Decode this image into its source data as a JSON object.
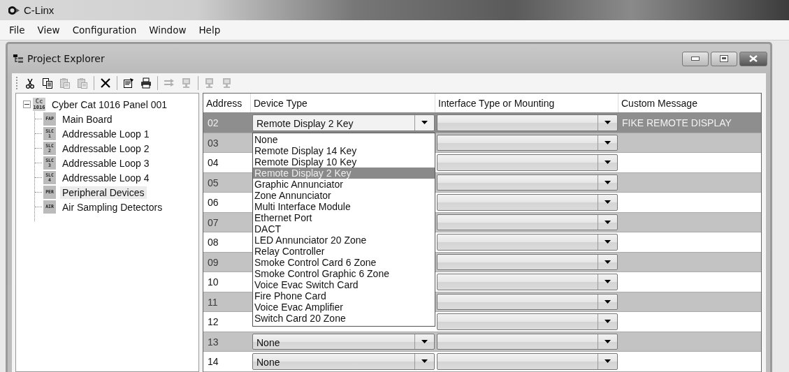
{
  "app": {
    "title": "C-Linx"
  },
  "menu": [
    {
      "label": "File"
    },
    {
      "label": "View"
    },
    {
      "label": "Configuration"
    },
    {
      "label": "Window"
    },
    {
      "label": "Help"
    }
  ],
  "child_window": {
    "title": "Project Explorer"
  },
  "toolbar": [
    {
      "kind": "cut",
      "disabled": false
    },
    {
      "kind": "copy",
      "disabled": false
    },
    {
      "kind": "paste",
      "disabled": true
    },
    {
      "kind": "paste",
      "disabled": true
    },
    {
      "kind": "separator"
    },
    {
      "kind": "delete",
      "disabled": false
    },
    {
      "kind": "separator"
    },
    {
      "kind": "properties",
      "disabled": false
    },
    {
      "kind": "print",
      "disabled": false
    },
    {
      "kind": "separator"
    },
    {
      "kind": "forward",
      "disabled": true
    },
    {
      "kind": "monitor",
      "disabled": true
    },
    {
      "kind": "separator"
    },
    {
      "kind": "monitor",
      "disabled": true
    },
    {
      "kind": "monitor",
      "disabled": true
    }
  ],
  "tree": {
    "label": "Cyber Cat 1016 Panel 001",
    "badge_lines": [
      "Cc",
      "1016"
    ],
    "expanded": true,
    "selected": false,
    "children": [
      {
        "label": "Main Board",
        "badge_lines": [
          "FAP"
        ],
        "selected": false
      },
      {
        "label": "Addressable Loop 1",
        "badge_lines": [
          "SLC",
          "1"
        ],
        "selected": false
      },
      {
        "label": "Addressable Loop 2",
        "badge_lines": [
          "SLC",
          "2"
        ],
        "selected": false
      },
      {
        "label": "Addressable Loop 3",
        "badge_lines": [
          "SLC",
          "3"
        ],
        "selected": false
      },
      {
        "label": "Addressable Loop 4",
        "badge_lines": [
          "SLC",
          "4"
        ],
        "selected": false
      },
      {
        "label": "Peripheral Devices",
        "badge_lines": [
          "PER"
        ],
        "selected": true
      },
      {
        "label": "Air Sampling Detectors",
        "badge_lines": [
          "AIR"
        ],
        "selected": false
      }
    ]
  },
  "grid": {
    "columns": [
      "Address",
      "Device Type",
      "Interface Type or Mounting",
      "Custom Message"
    ],
    "rows": [
      {
        "address": "02",
        "selected": true,
        "device_type": "Remote Display 2 Key",
        "custom_message": "FIKE REMOTE DISPLAY"
      },
      {
        "address": "03",
        "selected": false
      },
      {
        "address": "04",
        "selected": false
      },
      {
        "address": "05",
        "selected": false
      },
      {
        "address": "06",
        "selected": false
      },
      {
        "address": "07",
        "selected": false
      },
      {
        "address": "08",
        "selected": false
      },
      {
        "address": "09",
        "selected": false
      },
      {
        "address": "10",
        "selected": false
      },
      {
        "address": "11",
        "selected": false
      },
      {
        "address": "12",
        "selected": false
      },
      {
        "address": "13",
        "selected": false,
        "device_type": "None"
      },
      {
        "address": "14",
        "selected": false,
        "device_type": "None"
      }
    ],
    "dropdown": {
      "items": [
        {
          "label": "None",
          "selected": false
        },
        {
          "label": "Remote Display 14 Key",
          "selected": false
        },
        {
          "label": "Remote Display 10 Key",
          "selected": false
        },
        {
          "label": "Remote Display 2 Key",
          "selected": true
        },
        {
          "label": "Graphic Annunciator",
          "selected": false
        },
        {
          "label": "Zone Annunciator",
          "selected": false
        },
        {
          "label": "Multi Interface Module",
          "selected": false
        },
        {
          "label": "Ethernet Port",
          "selected": false
        },
        {
          "label": "DACT",
          "selected": false
        },
        {
          "label": "LED Annunciator 20 Zone",
          "selected": false
        },
        {
          "label": "Relay Controller",
          "selected": false
        },
        {
          "label": "Smoke Control Card 6 Zone",
          "selected": false
        },
        {
          "label": "Smoke Control Graphic 6 Zone",
          "selected": false
        },
        {
          "label": "Voice Evac Switch Card",
          "selected": false
        },
        {
          "label": "Fire Phone Card",
          "selected": false
        },
        {
          "label": "Voice Evac Amplifier",
          "selected": false
        },
        {
          "label": "Switch Card 20 Zone",
          "selected": false
        }
      ]
    }
  }
}
